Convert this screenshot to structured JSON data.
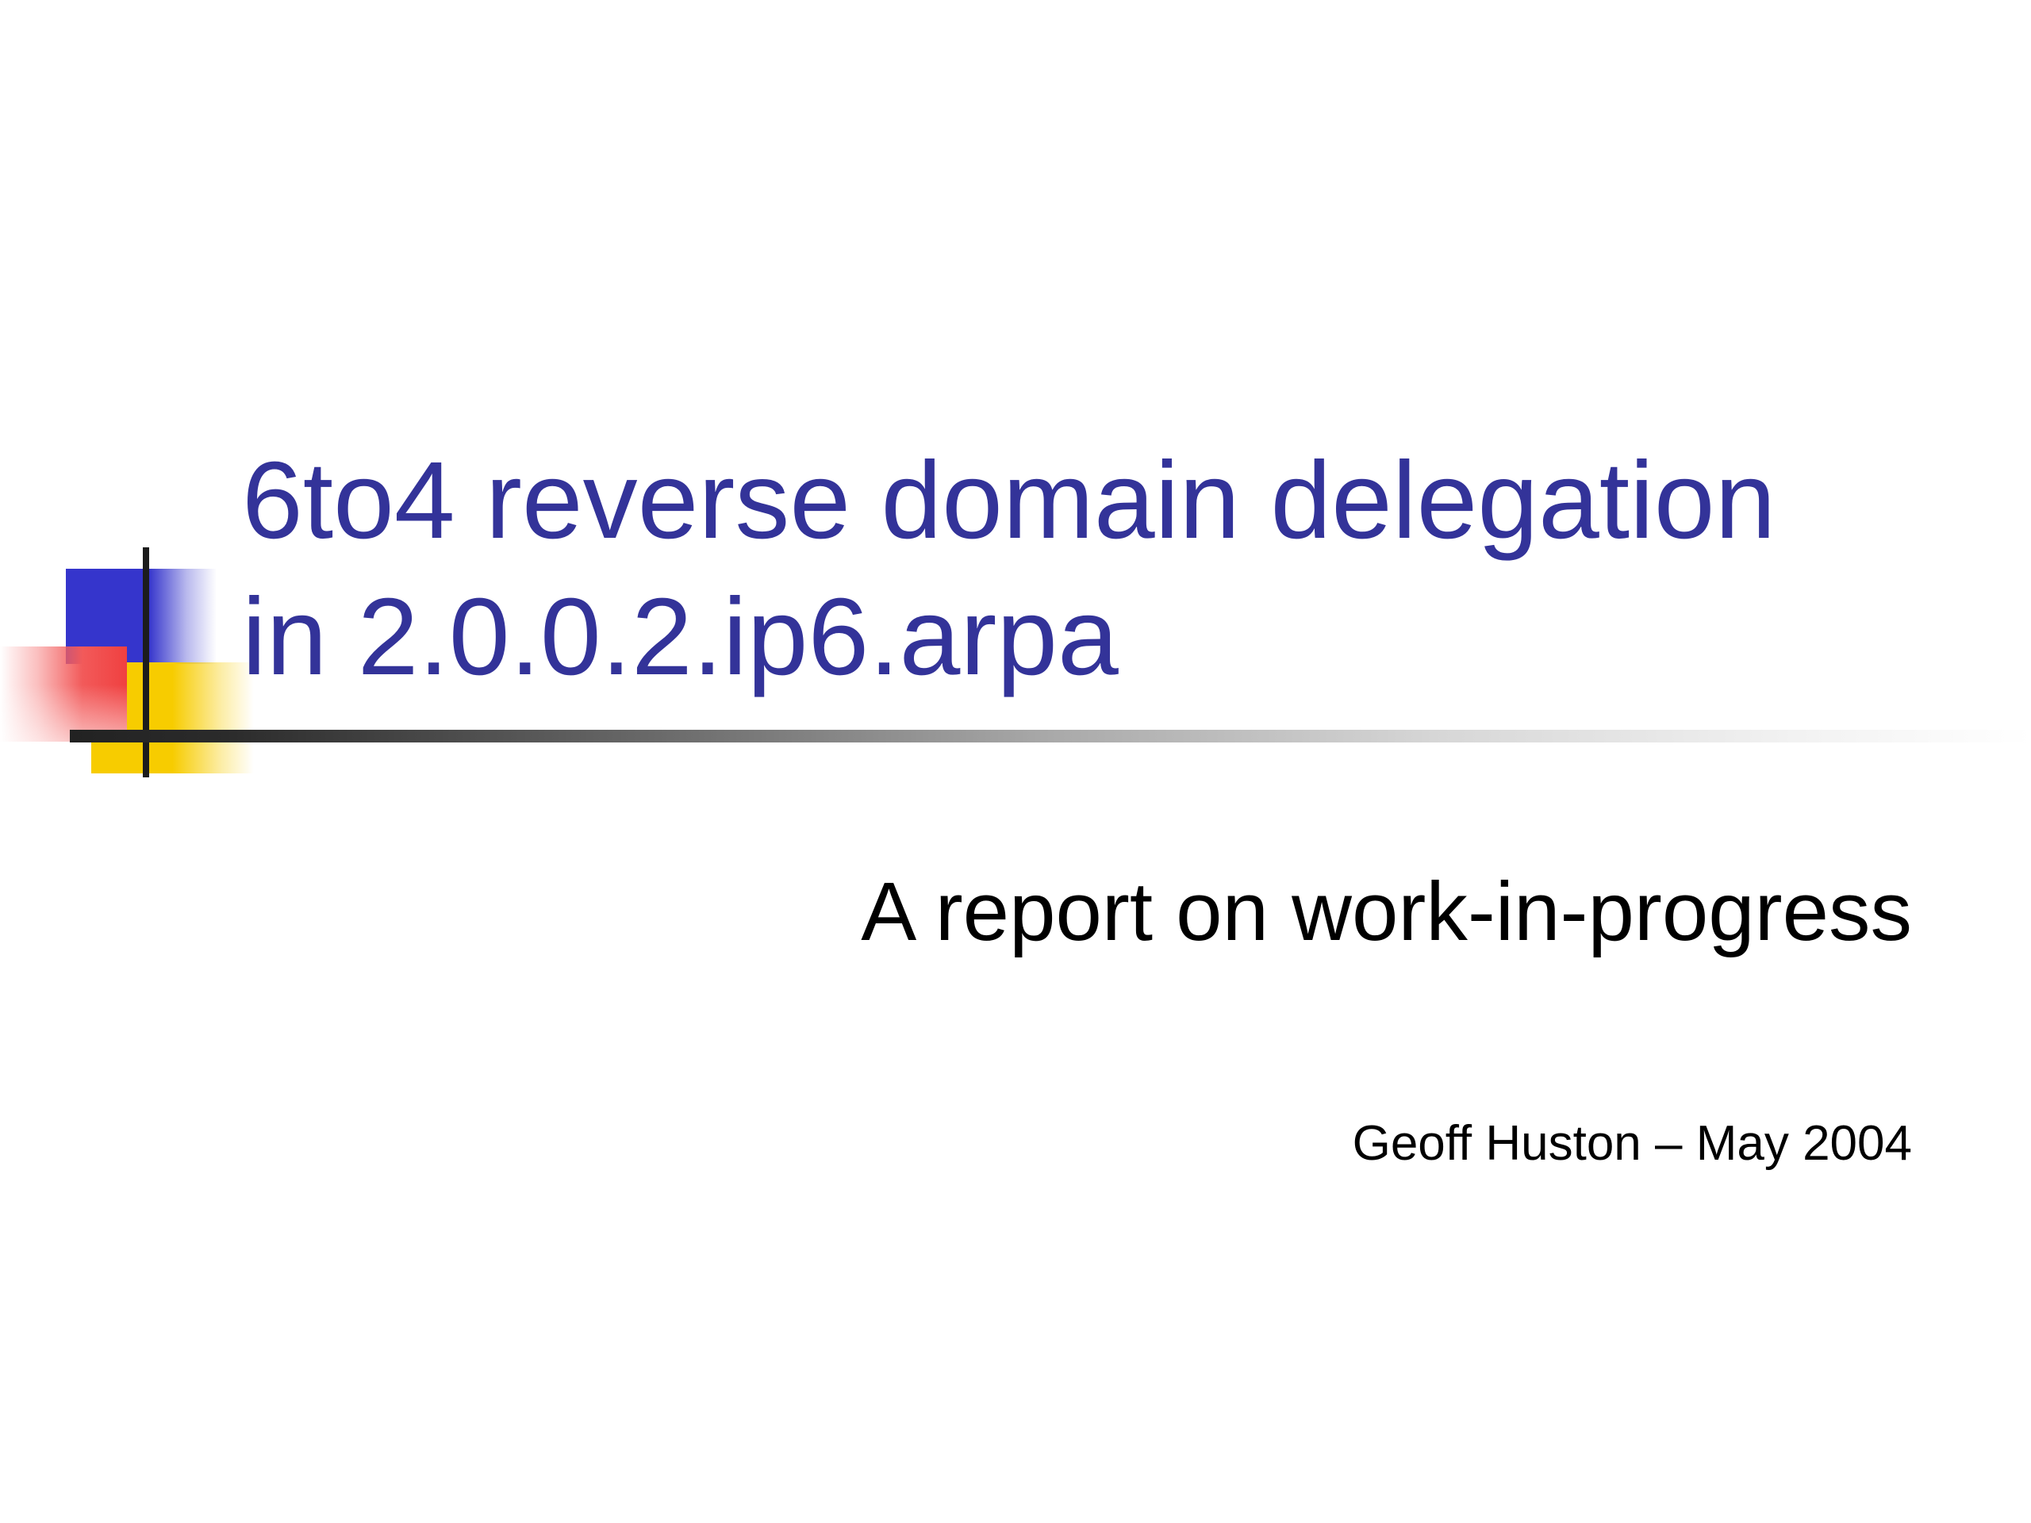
{
  "slide": {
    "title_lines": [
      "6to4 reverse domain delegation",
      "in 2.0.0.2.ip6.arpa"
    ],
    "subtitle": "A report on work-in-progress",
    "byline": "Geoff Huston – May 2004"
  },
  "colors": {
    "title": "#333399",
    "text": "#000000",
    "background": "#ffffff",
    "accent_blue": "#3535cc",
    "accent_yellow": "#f7cc00",
    "accent_red": "#f04040",
    "rule": "#222222"
  }
}
